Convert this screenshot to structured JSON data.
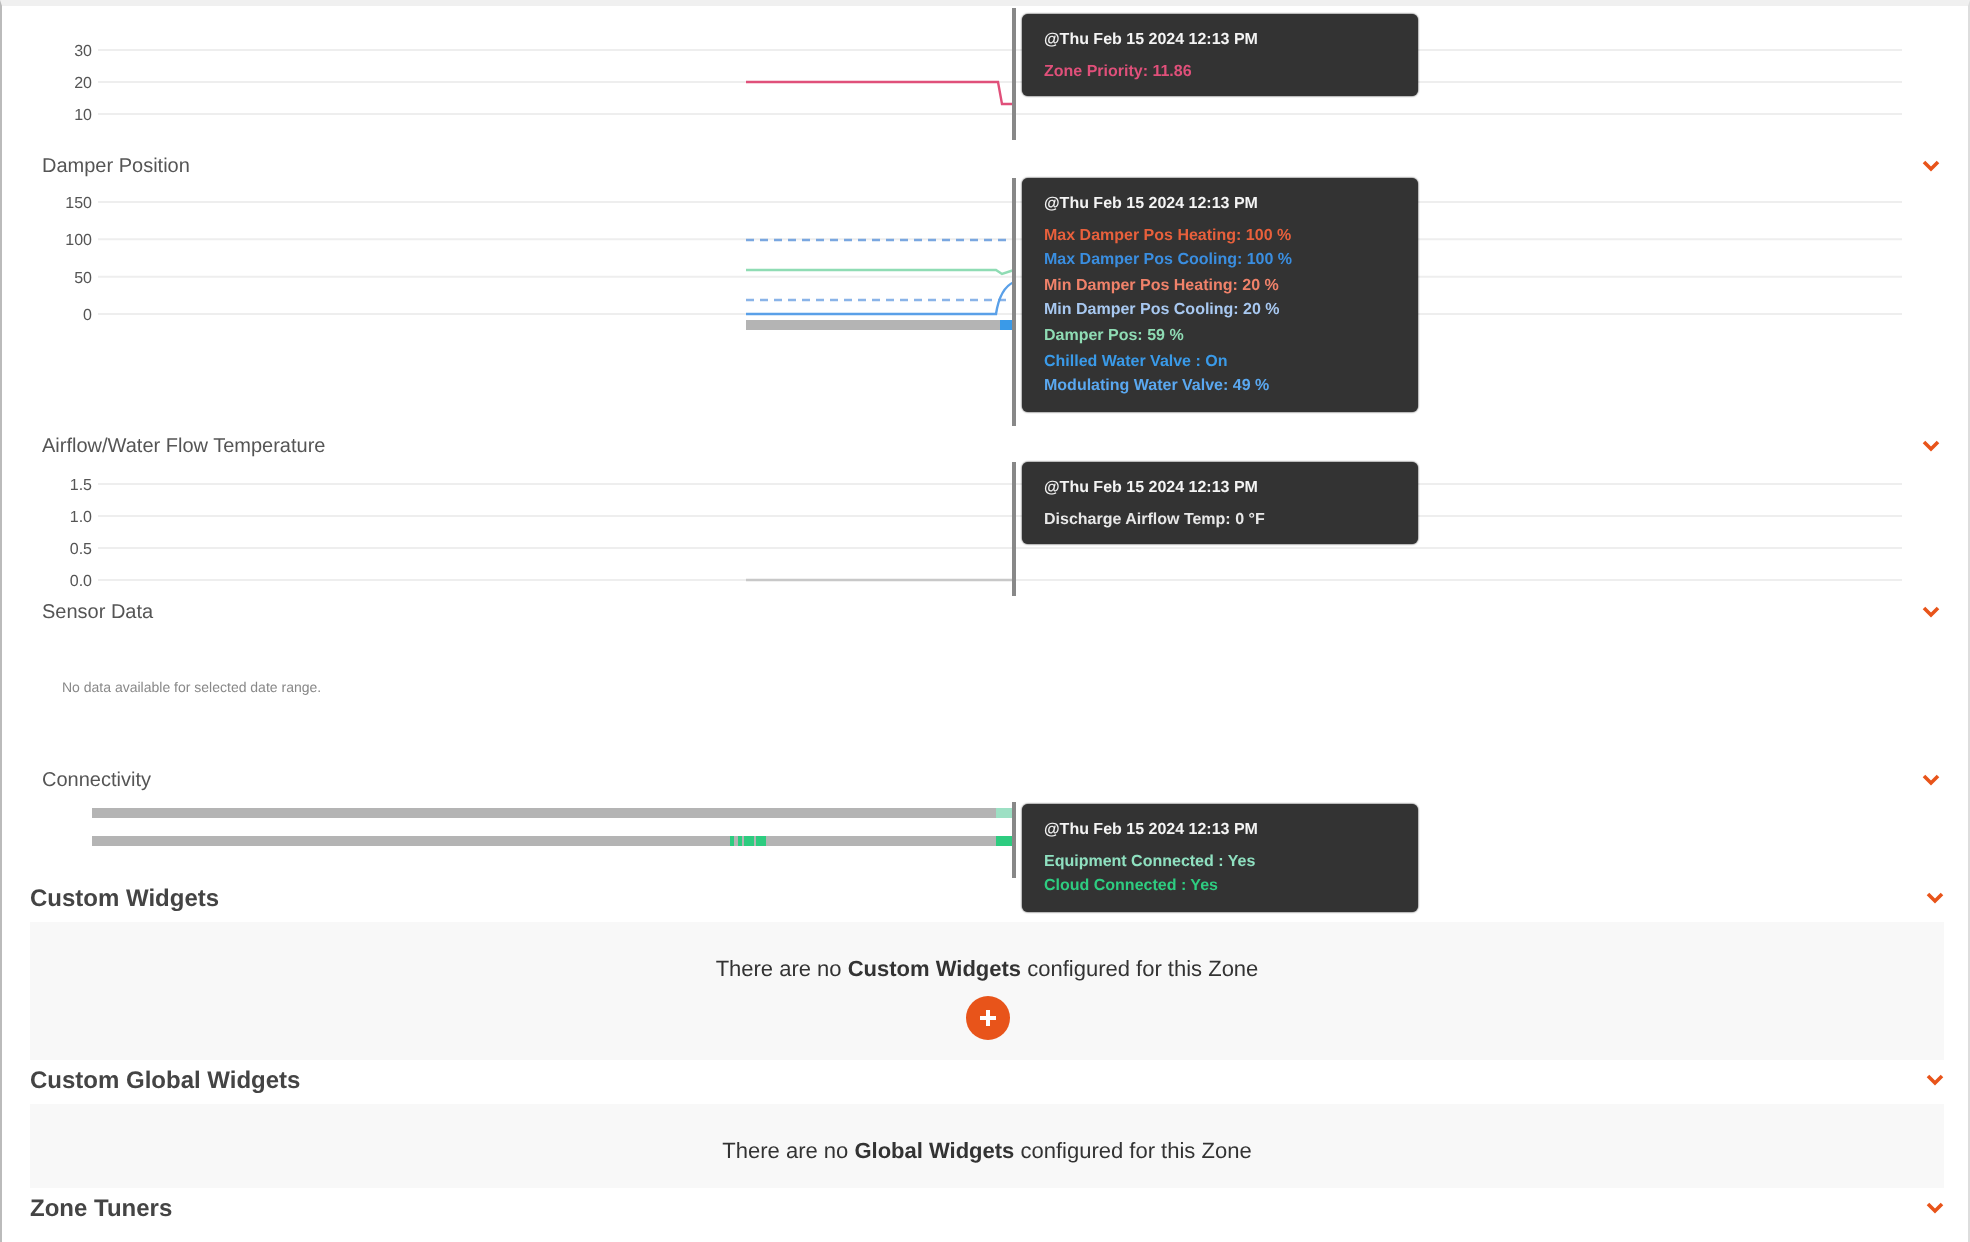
{
  "chart_sections": [
    {
      "kind": "line",
      "y_ticks": [
        "30",
        "20",
        "10"
      ],
      "tooltip": {
        "time": "@Thu Feb 15 2024 12:13 PM",
        "lines": [
          {
            "text": "Zone Priority: 11.86",
            "color": "#e0507a"
          }
        ]
      }
    },
    {
      "kind": "line",
      "title": "Damper Position",
      "y_ticks": [
        "150",
        "100",
        "50",
        "0"
      ],
      "tooltip": {
        "time": "@Thu Feb 15 2024 12:13 PM",
        "lines": [
          {
            "text": "Max Damper Pos Heating: 100 %",
            "color": "#e8603c"
          },
          {
            "text": "Max Damper Pos Cooling: 100 %",
            "color": "#3a8ee0"
          },
          {
            "text": "Min Damper Pos Heating: 20 %",
            "color": "#f0826a"
          },
          {
            "text": "Min Damper Pos Cooling: 20 %",
            "color": "#a8c8f0"
          },
          {
            "text": "Damper Pos: 59 %",
            "color": "#8fdcb4"
          },
          {
            "text": "Chilled Water Valve : On",
            "color": "#3a9ae8"
          },
          {
            "text": "Modulating Water Valve: 49 %",
            "color": "#5aa8f0"
          }
        ]
      }
    },
    {
      "kind": "line",
      "title": "Airflow/Water Flow Temperature",
      "y_ticks": [
        "1.5",
        "1.0",
        "0.5",
        "0.0"
      ],
      "tooltip": {
        "time": "@Thu Feb 15 2024 12:13 PM",
        "lines": [
          {
            "text": "Discharge Airflow Temp: 0 °F",
            "color": "#e8e8e8"
          }
        ]
      }
    },
    {
      "kind": "empty",
      "title": "Sensor Data",
      "message": "No data available for selected date range."
    },
    {
      "kind": "status",
      "title": "Connectivity",
      "tooltip": {
        "time": "@Thu Feb 15 2024 12:13 PM",
        "lines": [
          {
            "text": "Equipment Connected : Yes",
            "color": "#8fe0c0"
          },
          {
            "text": "Cloud Connected : Yes",
            "color": "#2ecc80"
          }
        ]
      }
    }
  ],
  "widget_sections": [
    {
      "title": "Custom Widgets",
      "message": "There are no **Custom Widgets** configured for this Zone",
      "add_button": true
    },
    {
      "title": "Custom Global Widgets",
      "message": "There are no **Global Widgets** configured for this Zone"
    },
    {
      "title": "Zone Tuners"
    }
  ]
}
